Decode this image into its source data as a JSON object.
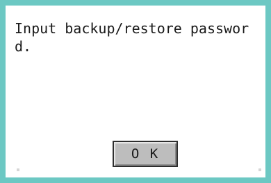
{
  "dialog": {
    "message": "Input backup/restore passwor\nd.",
    "ok_label": "O K"
  },
  "colors": {
    "frame_border": "#6cc8c3",
    "background": "#ffffff",
    "button_face": "#bdbdbd",
    "text": "#1a1a1a"
  }
}
